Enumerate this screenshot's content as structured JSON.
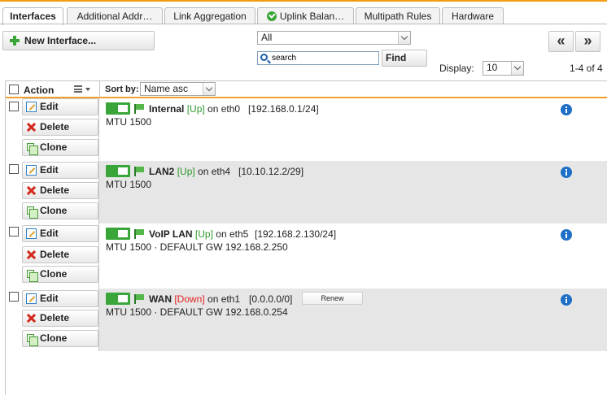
{
  "tabs": [
    {
      "label": "Interfaces",
      "active": true
    },
    {
      "label": "Additional Addr…",
      "active": false
    },
    {
      "label": "Link Aggregation",
      "active": false
    },
    {
      "label": "Uplink Balan…",
      "active": false,
      "icon": "check-circle-icon"
    },
    {
      "label": "Multipath Rules",
      "active": false
    },
    {
      "label": "Hardware",
      "active": false
    }
  ],
  "toolbar": {
    "new_label": "New Interface...",
    "filter_value": "All",
    "search_placeholder": "search",
    "find_label": "Find",
    "prev_label": "«",
    "next_label": "»",
    "display_label": "Display:",
    "display_value": "10",
    "count": "1-4 of 4"
  },
  "table": {
    "header": {
      "action": "Action",
      "sort_label": "Sort by:",
      "sort_value": "Name asc"
    },
    "buttons": {
      "edit": "Edit",
      "delete": "Delete",
      "clone": "Clone"
    },
    "rows": [
      {
        "name": "Internal",
        "status": "[Up]",
        "on": "on eth0",
        "ip": "[192.168.0.1/24]",
        "details": "MTU 1500"
      },
      {
        "name": "LAN2",
        "status": "[Up]",
        "on": "on eth4",
        "ip": "[10.10.12.2/29]",
        "details": "MTU 1500"
      },
      {
        "name": "VoIP LAN",
        "status": "[Up]",
        "on": "on eth5",
        "ip": "[192.168.2.130/24]",
        "details": "MTU 1500 · DEFAULT GW 192.168.2.250"
      },
      {
        "name": "WAN",
        "status": "[Down]",
        "on": "on eth1",
        "ip": "[0.0.0.0/0]",
        "details": "MTU 1500 · DEFAULT GW 192.168.0.254",
        "renew_label": "Renew"
      }
    ]
  },
  "colors": {
    "accent": "#f39c12",
    "toggle_on": "#3aa63a",
    "status_up": "#2e9a2e",
    "status_down": "#e02020",
    "info": "#1d6fc7"
  }
}
